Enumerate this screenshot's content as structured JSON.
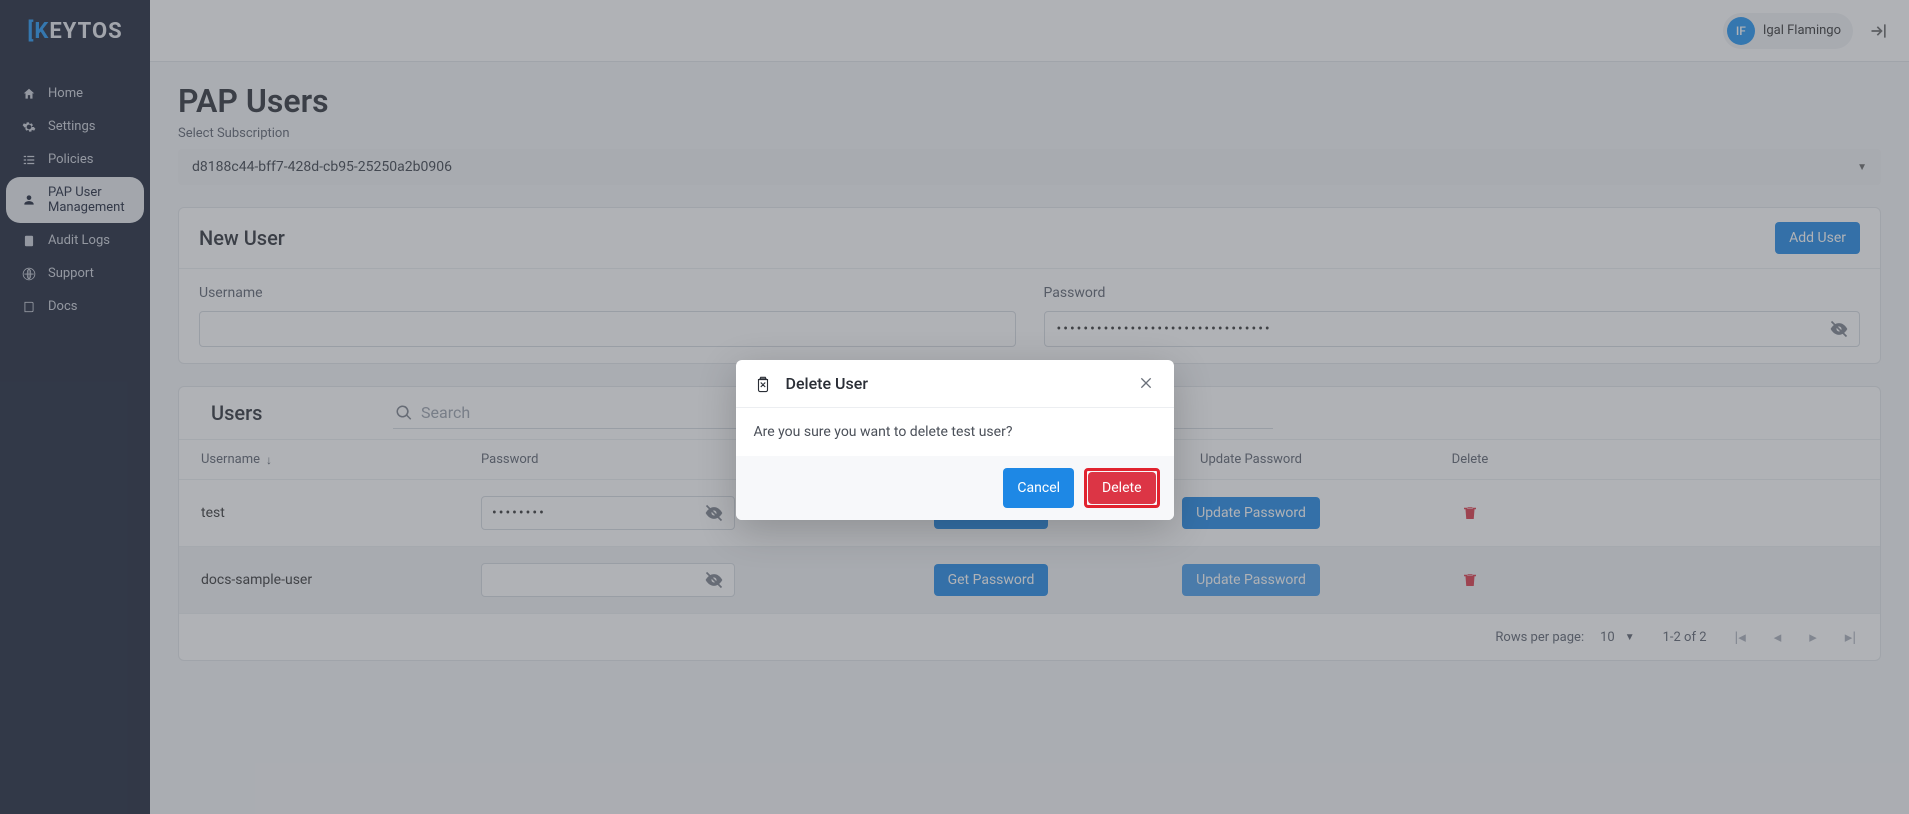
{
  "brand": "KEYTOS",
  "user": {
    "initials": "IF",
    "name": "Igal Flamingo"
  },
  "sidebar": {
    "items": [
      {
        "label": "Home"
      },
      {
        "label": "Settings"
      },
      {
        "label": "Policies"
      },
      {
        "label": "PAP User Management"
      },
      {
        "label": "Audit Logs"
      },
      {
        "label": "Support"
      },
      {
        "label": "Docs"
      }
    ]
  },
  "page": {
    "title": "PAP Users",
    "subscription_label": "Select Subscription",
    "subscription_value": "d8188c44-bff7-428d-cb95-25250a2b0906"
  },
  "new_user": {
    "title": "New User",
    "add_button": "Add User",
    "username_label": "Username",
    "username_value": "",
    "password_label": "Password",
    "password_value": "••••••••••••••••••••••••••••••••"
  },
  "users": {
    "title": "Users",
    "search_placeholder": "Search",
    "columns": {
      "username": "Username",
      "password": "Password",
      "update": "Update Password",
      "delete": "Delete"
    },
    "row_buttons": {
      "get_password": "Get Password",
      "update_password": "Update Password"
    },
    "rows": [
      {
        "username": "test",
        "password_mask": "••••••••"
      },
      {
        "username": "docs-sample-user",
        "password_mask": ""
      }
    ],
    "footer": {
      "rows_per_page_label": "Rows per page:",
      "rows_per_page_value": "10",
      "range": "1-2 of 2"
    }
  },
  "modal": {
    "title": "Delete User",
    "message": "Are you sure you want to delete test user?",
    "cancel": "Cancel",
    "delete": "Delete"
  }
}
